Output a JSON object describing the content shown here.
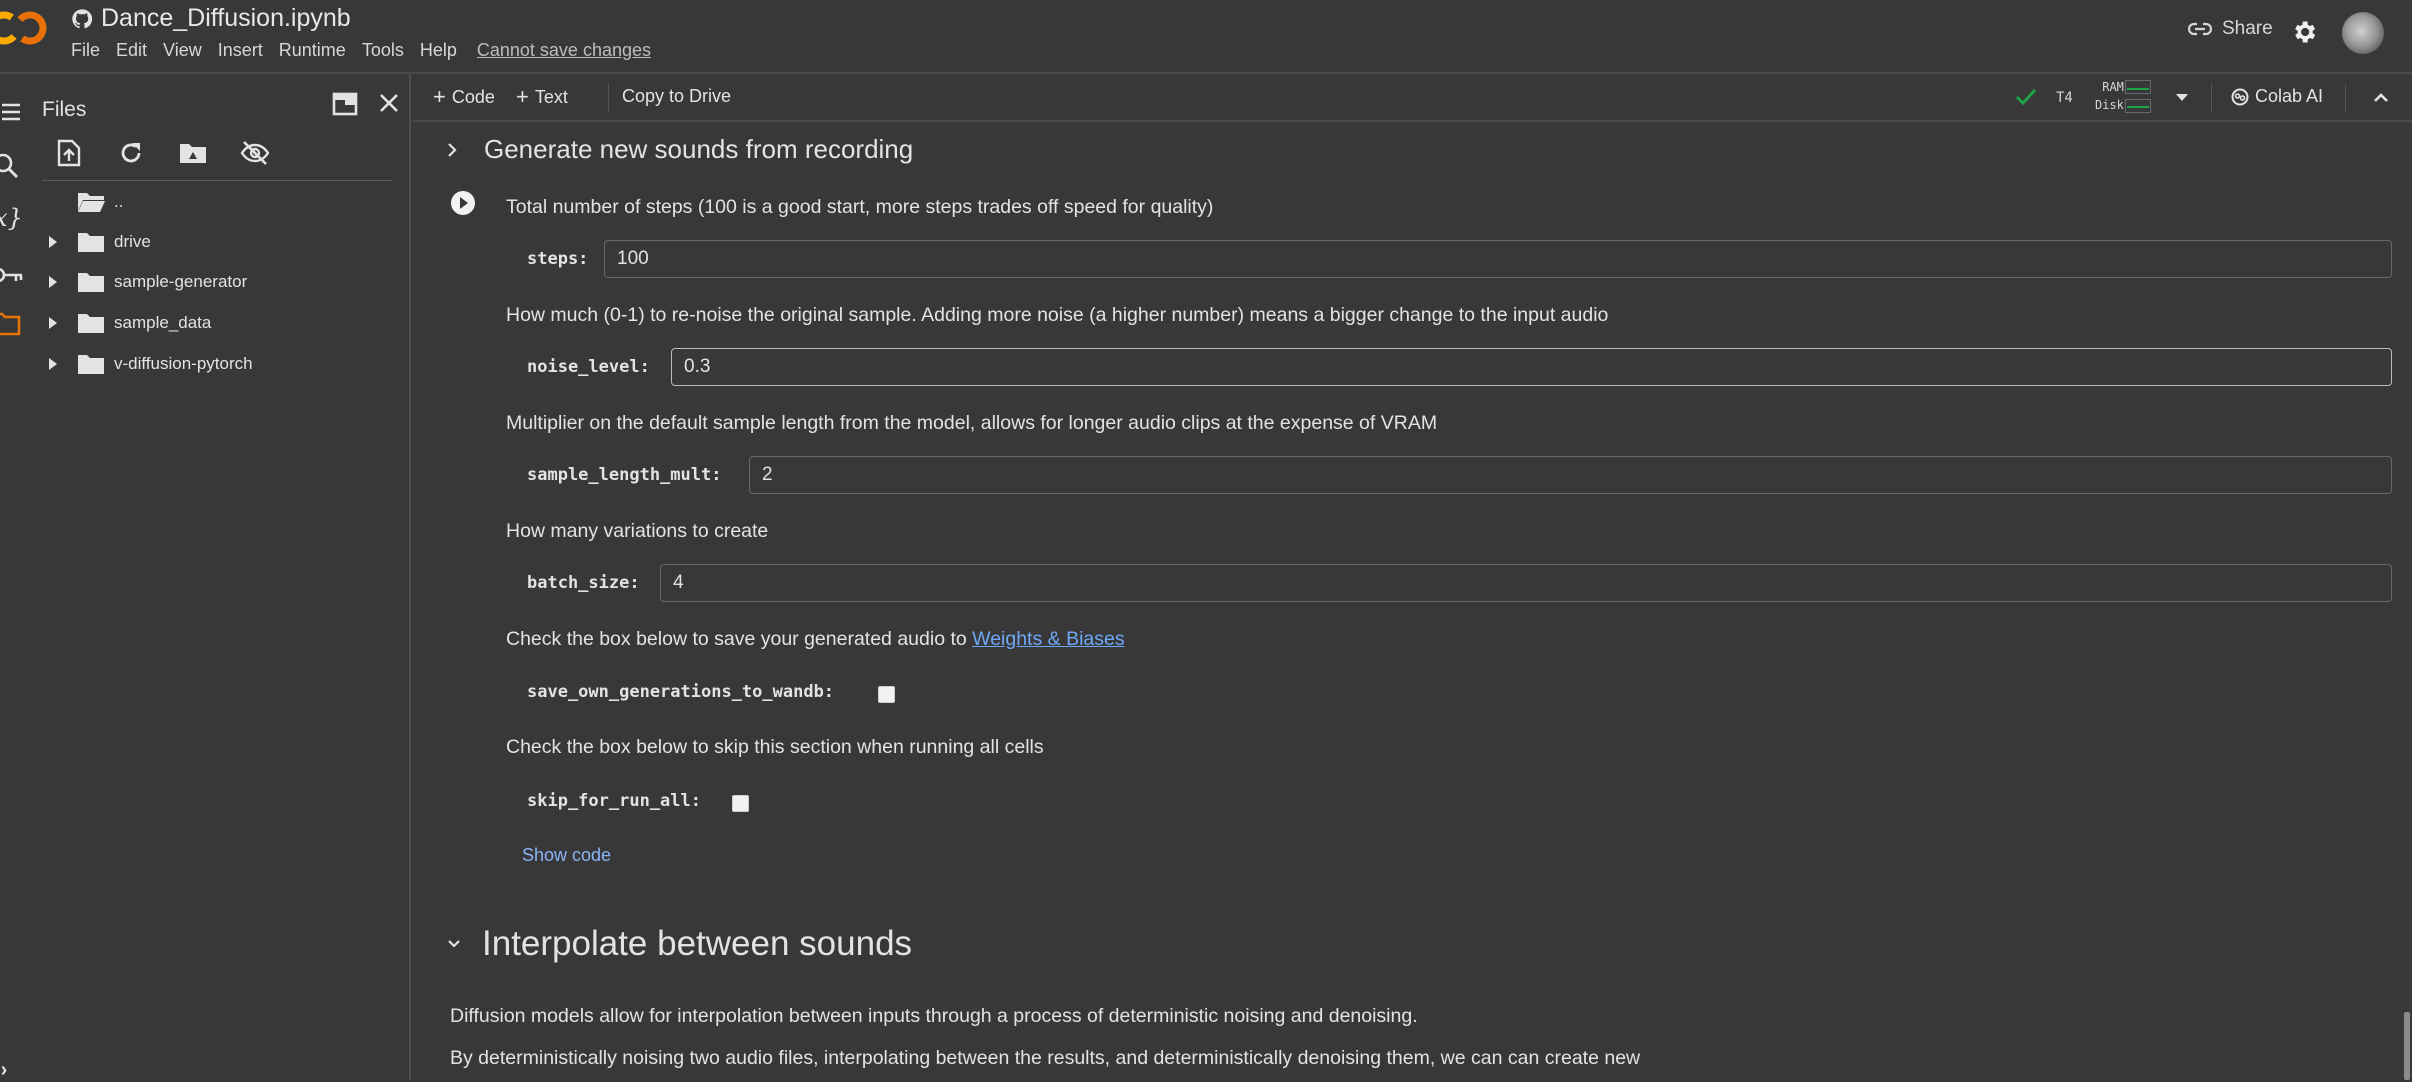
{
  "header": {
    "title": "Dance_Diffusion.ipynb",
    "menu": [
      "File",
      "Edit",
      "View",
      "Insert",
      "Runtime",
      "Tools",
      "Help"
    ],
    "save_status": "Cannot save changes",
    "share_label": "Share"
  },
  "sidebar": {
    "title": "Files",
    "files": [
      {
        "name": "..",
        "type": "parent"
      },
      {
        "name": "drive",
        "type": "folder"
      },
      {
        "name": "sample-generator",
        "type": "folder"
      },
      {
        "name": "sample_data",
        "type": "folder"
      },
      {
        "name": "v-diffusion-pytorch",
        "type": "folder"
      }
    ]
  },
  "toolbar": {
    "add_code": "Code",
    "add_text": "Text",
    "copy_to_drive": "Copy to Drive",
    "runtime_type": "T4",
    "ram_label": "RAM",
    "disk_label": "Disk",
    "colab_ai": "Colab AI"
  },
  "main": {
    "section1_title": "Generate new sounds from recording",
    "fields": [
      {
        "desc": "Total number of steps (100 is a good start, more steps trades off speed for quality)",
        "label": "steps:",
        "value": "100"
      },
      {
        "desc": "How much (0-1) to re-noise the original sample. Adding more noise (a higher number) means a bigger change to the input audio",
        "label": "noise_level:",
        "value": "0.3"
      },
      {
        "desc": "Multiplier on the default sample length from the model, allows for longer audio clips at the expense of VRAM",
        "label": "sample_length_mult:",
        "value": "2"
      },
      {
        "desc": "How many variations to create",
        "label": "batch_size:",
        "value": "4"
      }
    ],
    "wandb_desc_prefix": "Check the box below to save your generated audio to ",
    "wandb_link": "Weights & Biases",
    "wandb_label": "save_own_generations_to_wandb:",
    "wandb_checked": false,
    "skip_desc": "Check the box below to skip this section when running all cells",
    "skip_label": "skip_for_run_all:",
    "skip_checked": false,
    "show_code": "Show code",
    "section2_title": "Interpolate between sounds",
    "para1": "Diffusion models allow for interpolation between inputs through a process of deterministic noising and denoising.",
    "para2": "By deterministically noising two audio files, interpolating between the results, and deterministically denoising them, we can can create new"
  }
}
